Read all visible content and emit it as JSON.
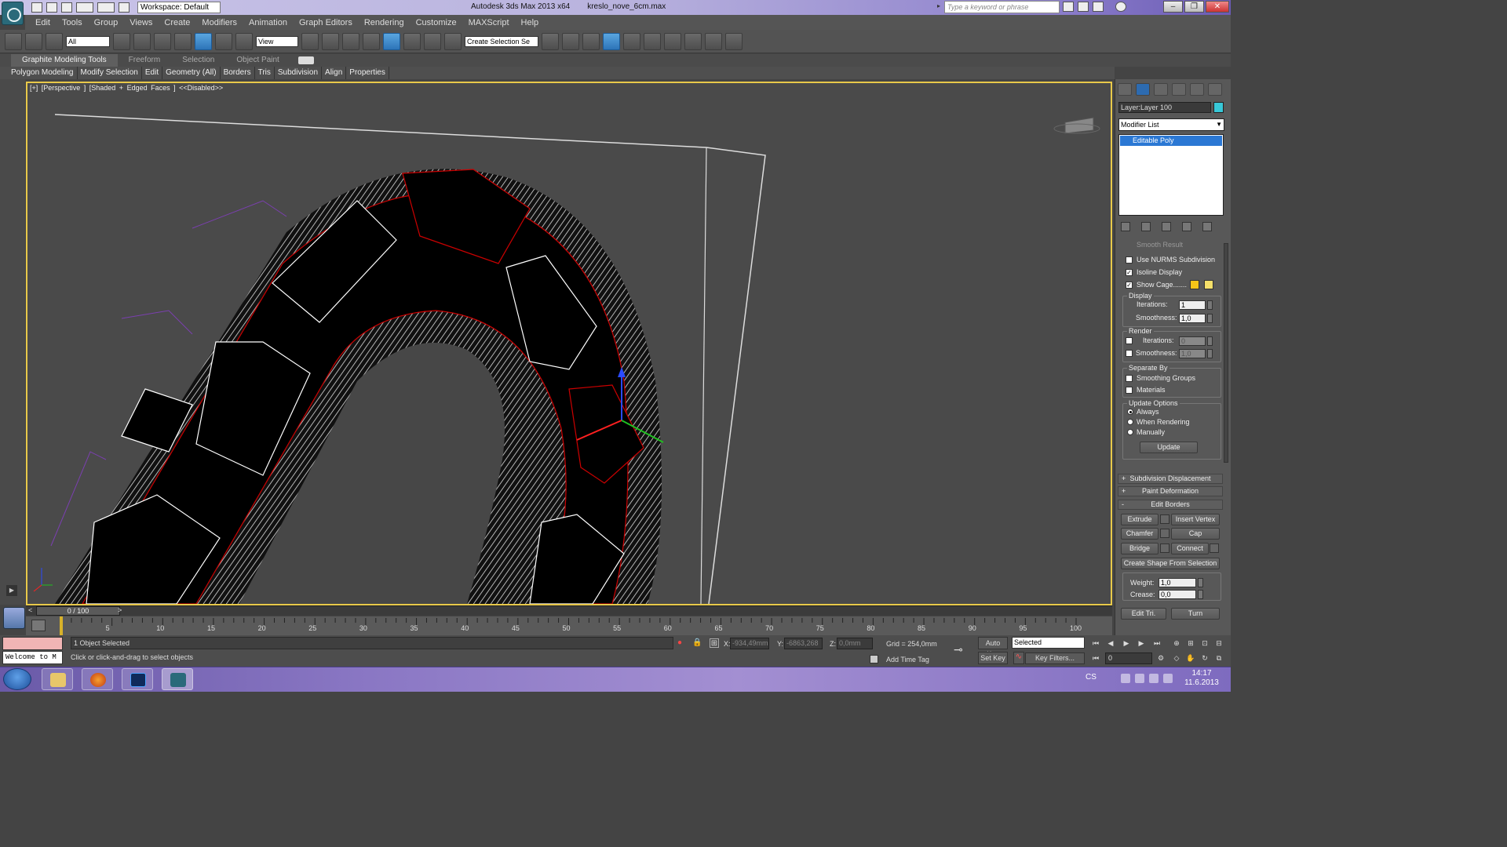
{
  "titlebar": {
    "workspace": "Workspace: Default",
    "app_title": "Autodesk 3ds Max  2013 x64",
    "file_name": "kreslo_nove_6cm.max",
    "search_placeholder": "Type a keyword or phrase",
    "window_buttons": [
      "–",
      "❐",
      "✕"
    ]
  },
  "menu": [
    "Edit",
    "Tools",
    "Group",
    "Views",
    "Create",
    "Modifiers",
    "Animation",
    "Graph Editors",
    "Rendering",
    "Customize",
    "MAXScript",
    "Help"
  ],
  "toolbar": {
    "selection_filter": "All",
    "ref_coord": "View",
    "named_selection": "Create Selection Se"
  },
  "ribbon": {
    "tabs": [
      "Graphite Modeling Tools",
      "Freeform",
      "Selection",
      "Object Paint"
    ],
    "panels": [
      "Polygon Modeling",
      "Modify Selection",
      "Edit",
      "Geometry (All)",
      "Borders",
      "Tris",
      "Subdivision",
      "Align",
      "Properties"
    ]
  },
  "viewport": {
    "label": "[+] [Perspective ] [Shaded + Edged Faces ]  <<Disabled>>"
  },
  "command_panel": {
    "layer": "Layer:Layer 100",
    "layer_color": "#38c8d8",
    "modifier_list": "Modifier List",
    "stack_item": "Editable Poly",
    "cut_label": "Smooth Result",
    "use_nurms": "Use NURMS Subdivision",
    "isoline": "Isoline Display",
    "show_cage": "Show Cage.......",
    "cage_colors": [
      "#f5c518",
      "#f5e06a"
    ],
    "display_group": "Display",
    "render_group": "Render",
    "iterations_label": "Iterations:",
    "smoothness_label": "Smoothness:",
    "display_iterations": "1",
    "display_smoothness": "1,0",
    "render_iterations": "0",
    "render_smoothness": "1,0",
    "separate_by": "Separate By",
    "smoothing_groups": "Smoothing Groups",
    "materials": "Materials",
    "update_options": "Update Options",
    "always": "Always",
    "when_rendering": "When Rendering",
    "manually": "Manually",
    "update_button": "Update",
    "rollouts": [
      "Subdivision Displacement",
      "Paint Deformation",
      "Edit Borders"
    ],
    "rollout_signs": [
      "+",
      "+",
      "-"
    ],
    "extrude": "Extrude",
    "insert_vertex": "Insert Vertex",
    "chamfer": "Chamfer",
    "cap": "Cap",
    "bridge": "Bridge",
    "connect": "Connect",
    "create_shape": "Create Shape From Selection",
    "weight_label": "Weight:",
    "weight_value": "1,0",
    "crease_label": "Crease:",
    "crease_value": "0,0",
    "edit_tri": "Edit Tri.",
    "turn": "Turn"
  },
  "timeline": {
    "position": "0 / 100",
    "ticks": [
      "5",
      "10",
      "15",
      "20",
      "25",
      "30",
      "35",
      "40",
      "45",
      "50",
      "55",
      "60",
      "65",
      "70",
      "75",
      "80",
      "85",
      "90",
      "95",
      "100"
    ]
  },
  "status": {
    "maxscript": "Welcome to M",
    "selection": "1 Object Selected",
    "prompt": "Click or click-and-drag to select objects",
    "x_label": "X:",
    "x_value": "-934,49mm",
    "y_label": "Y:",
    "y_value": "-6863,268",
    "z_label": "Z:",
    "z_value": "0,0mm",
    "grid": "Grid = 254,0mm",
    "add_time_tag": "Add Time Tag",
    "auto_key": "Auto Key",
    "set_key": "Set Key",
    "key_mode": "Selected",
    "key_filters": "Key Filters...",
    "frame": "0"
  },
  "taskbar": {
    "language": "CS",
    "time": "14:17",
    "date": "11.6.2013"
  }
}
